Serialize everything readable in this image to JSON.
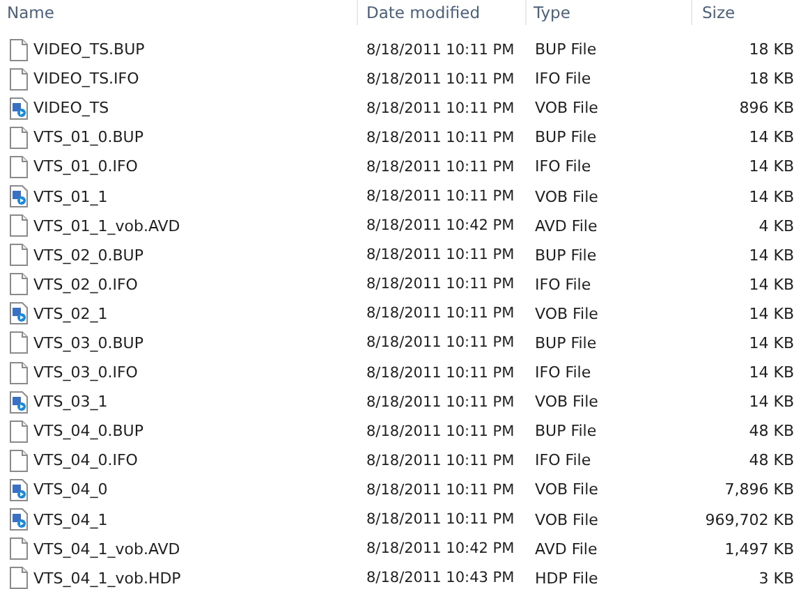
{
  "columns": [
    "Name",
    "Date modified",
    "Type",
    "Size"
  ],
  "rows": [
    {
      "kind": "document",
      "name": "VIDEO_TS.BUP",
      "date": "8/18/2011 10:11 PM",
      "type": "BUP File",
      "size": "18 KB"
    },
    {
      "kind": "document",
      "name": "VIDEO_TS.IFO",
      "date": "8/18/2011 10:11 PM",
      "type": "IFO File",
      "size": "18 KB"
    },
    {
      "kind": "media",
      "name": "VIDEO_TS",
      "date": "8/18/2011 10:11 PM",
      "type": "VOB File",
      "size": "896 KB"
    },
    {
      "kind": "document",
      "name": "VTS_01_0.BUP",
      "date": "8/18/2011 10:11 PM",
      "type": "BUP File",
      "size": "14 KB"
    },
    {
      "kind": "document",
      "name": "VTS_01_0.IFO",
      "date": "8/18/2011 10:11 PM",
      "type": "IFO File",
      "size": "14 KB"
    },
    {
      "kind": "media",
      "name": "VTS_01_1",
      "date": "8/18/2011 10:11 PM",
      "type": "VOB File",
      "size": "14 KB"
    },
    {
      "kind": "document",
      "name": "VTS_01_1_vob.AVD",
      "date": "8/18/2011 10:42 PM",
      "type": "AVD File",
      "size": "4 KB"
    },
    {
      "kind": "document",
      "name": "VTS_02_0.BUP",
      "date": "8/18/2011 10:11 PM",
      "type": "BUP File",
      "size": "14 KB"
    },
    {
      "kind": "document",
      "name": "VTS_02_0.IFO",
      "date": "8/18/2011 10:11 PM",
      "type": "IFO File",
      "size": "14 KB"
    },
    {
      "kind": "media",
      "name": "VTS_02_1",
      "date": "8/18/2011 10:11 PM",
      "type": "VOB File",
      "size": "14 KB"
    },
    {
      "kind": "document",
      "name": "VTS_03_0.BUP",
      "date": "8/18/2011 10:11 PM",
      "type": "BUP File",
      "size": "14 KB"
    },
    {
      "kind": "document",
      "name": "VTS_03_0.IFO",
      "date": "8/18/2011 10:11 PM",
      "type": "IFO File",
      "size": "14 KB"
    },
    {
      "kind": "media",
      "name": "VTS_03_1",
      "date": "8/18/2011 10:11 PM",
      "type": "VOB File",
      "size": "14 KB"
    },
    {
      "kind": "document",
      "name": "VTS_04_0.BUP",
      "date": "8/18/2011 10:11 PM",
      "type": "BUP File",
      "size": "48 KB"
    },
    {
      "kind": "document",
      "name": "VTS_04_0.IFO",
      "date": "8/18/2011 10:11 PM",
      "type": "IFO File",
      "size": "48 KB"
    },
    {
      "kind": "media",
      "name": "VTS_04_0",
      "date": "8/18/2011 10:11 PM",
      "type": "VOB File",
      "size": "7,896 KB"
    },
    {
      "kind": "media",
      "name": "VTS_04_1",
      "date": "8/18/2011 10:11 PM",
      "type": "VOB File",
      "size": "969,702 KB"
    },
    {
      "kind": "document",
      "name": "VTS_04_1_vob.AVD",
      "date": "8/18/2011 10:42 PM",
      "type": "AVD File",
      "size": "1,497 KB"
    },
    {
      "kind": "document",
      "name": "VTS_04_1_vob.HDP",
      "date": "8/18/2011 10:43 PM",
      "type": "HDP File",
      "size": "3 KB"
    }
  ]
}
